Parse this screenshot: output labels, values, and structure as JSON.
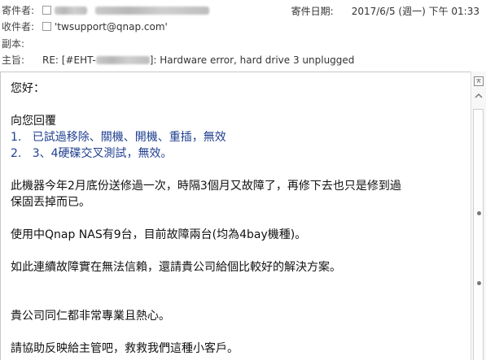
{
  "header": {
    "from_label": "寄件者:",
    "to_label": "收件者:",
    "to_value": "'twsupport@qnap.com'",
    "cc_label": "副本:",
    "subject_label": "主旨:",
    "subject_prefix": "RE: [#EHT-",
    "subject_suffix": "]: Hardware error, hard drive 3 unplugged",
    "date_label": "寄件日期:",
    "date_value": "2017/6/5 (週一) 下午 01:33"
  },
  "body": {
    "greeting": "您好：",
    "reply_intro": "向您回覆",
    "item1": "1.   已試過移除、關機、開機、重插，無效",
    "item2": "2.   3、4硬碟交叉測試，無效。",
    "para1_line1": "此機器今年2月底份送修過一次，時隔3個月又故障了，再修下去也只是修到過",
    "para1_line2": "保固丟掉而已。",
    "para2": "使用中Qnap NAS有9台，目前故障兩台(均為4bay機種)。",
    "para3": "如此連續故障實在無法信賴，還請貴公司給個比較好的解決方案。",
    "para4": "貴公司同仁都非常專業且熱心。",
    "para5": "請協助反映給主管吧，救救我們這種小客戶。"
  }
}
